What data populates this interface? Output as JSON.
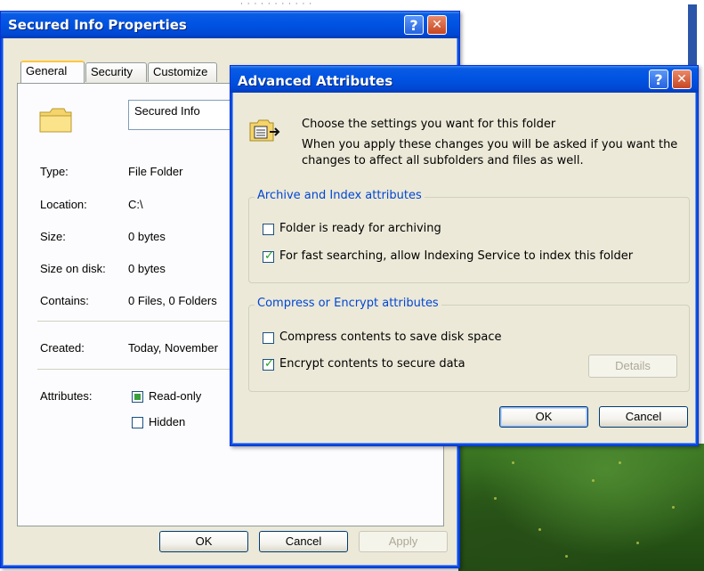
{
  "desktop": {
    "stray_text": "· · · · · · · · · · ·"
  },
  "properties": {
    "title": "Secured Info Properties",
    "help_glyph": "?",
    "close_glyph": "✕",
    "tabs": [
      "General",
      "Security",
      "Customize"
    ],
    "folder_name": "Secured Info",
    "rows": [
      {
        "label": "Type:",
        "value": "File Folder"
      },
      {
        "label": "Location:",
        "value": "C:\\"
      },
      {
        "label": "Size:",
        "value": "0 bytes"
      },
      {
        "label": "Size on disk:",
        "value": "0 bytes"
      },
      {
        "label": "Contains:",
        "value": "0 Files, 0 Folders"
      }
    ],
    "created_label": "Created:",
    "created_value": "Today, November",
    "attributes_label": "Attributes:",
    "attr_readonly": "Read-only",
    "attr_hidden": "Hidden",
    "ok": "OK",
    "cancel": "Cancel",
    "apply": "Apply"
  },
  "advanced": {
    "title": "Advanced Attributes",
    "help_glyph": "?",
    "close_glyph": "✕",
    "intro": "Choose the settings you want for this folder",
    "note_line1": "When you apply these changes you will be asked if you want the",
    "note_line2": "changes to affect all subfolders and files as well.",
    "group1_title": "Archive and Index attributes",
    "archive_label": "Folder is ready for archiving",
    "index_label": "For fast searching, allow Indexing Service to index this folder",
    "group2_title": "Compress or Encrypt attributes",
    "compress_label": "Compress contents to save disk space",
    "encrypt_label": "Encrypt contents to secure data",
    "details": "Details",
    "ok": "OK",
    "cancel": "Cancel",
    "checks": {
      "archive": false,
      "index": true,
      "compress": false,
      "encrypt": true
    }
  },
  "colors": {
    "title_blue": "#0054e3",
    "group_title": "#0046d5",
    "check_green": "#21a121"
  }
}
